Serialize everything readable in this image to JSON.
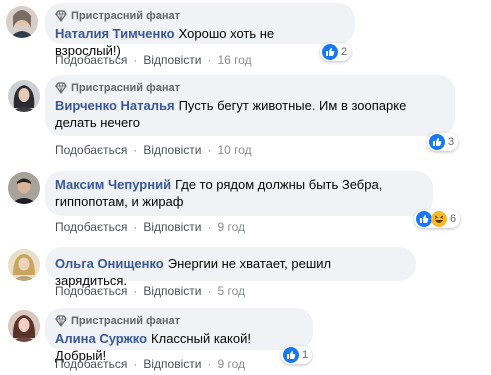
{
  "comments": [
    {
      "badge": "Пристрасний фанат",
      "author": "Наталия Тимченко",
      "text": "Хорошо хоть не взрослый!)",
      "like_label": "Подобається",
      "reply_label": "Відповісти",
      "time": "16 год",
      "reaction_count": "2",
      "reactions": [
        "like-icon"
      ],
      "avatar_color": "#7a6b63"
    },
    {
      "badge": "Пристрасний фанат",
      "author": "Вирченко Наталья",
      "text": "Пусть бегут животные. Им в зоопарке делать нечего",
      "like_label": "Подобається",
      "reply_label": "Відповісти",
      "time": "10 год",
      "reaction_count": "3",
      "reactions": [
        "like-icon"
      ],
      "avatar_color": "#3b3a40"
    },
    {
      "badge": "",
      "author": "Максим Чепурний",
      "text": "Где то рядом должны быть Зебра, гиппопотам, и жираф",
      "like_label": "Подобається",
      "reply_label": "Відповісти",
      "time": "9 год",
      "reaction_count": "6",
      "reactions": [
        "like-icon",
        "haha-icon"
      ],
      "avatar_color": "#8b7a6a"
    },
    {
      "badge": "",
      "author": "Ольга Онищенко",
      "text": "Энергии не хватает, решил зарядиться.",
      "like_label": "Подобається",
      "reply_label": "Відповісти",
      "time": "5 год",
      "reaction_count": "",
      "reactions": [],
      "avatar_color": "#c9b48d"
    },
    {
      "badge": "Пристрасний фанат",
      "author": "Алина Суржко",
      "text": "Классный какой! Добрый!",
      "like_label": "Подобається",
      "reply_label": "Відповісти",
      "time": "9 год",
      "reaction_count": "1",
      "reactions": [
        "like-icon"
      ],
      "avatar_color": "#6e4a3e"
    }
  ],
  "colors": {
    "bubble": "#f0f2f5",
    "author": "#385898",
    "like_blue": "#1877f2",
    "haha_yellow": "#f7b928"
  }
}
